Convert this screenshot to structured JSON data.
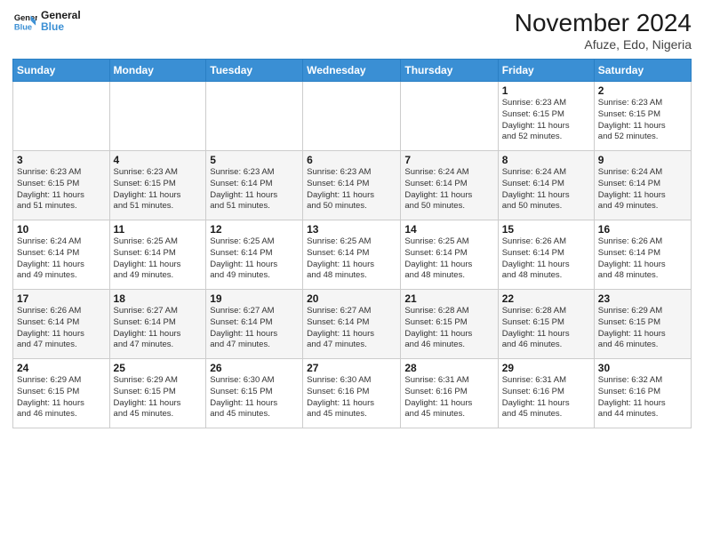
{
  "header": {
    "logo_line1": "General",
    "logo_line2": "Blue",
    "month": "November 2024",
    "location": "Afuze, Edo, Nigeria"
  },
  "weekdays": [
    "Sunday",
    "Monday",
    "Tuesday",
    "Wednesday",
    "Thursday",
    "Friday",
    "Saturday"
  ],
  "weeks": [
    [
      {
        "day": "",
        "info": ""
      },
      {
        "day": "",
        "info": ""
      },
      {
        "day": "",
        "info": ""
      },
      {
        "day": "",
        "info": ""
      },
      {
        "day": "",
        "info": ""
      },
      {
        "day": "1",
        "info": "Sunrise: 6:23 AM\nSunset: 6:15 PM\nDaylight: 11 hours\nand 52 minutes."
      },
      {
        "day": "2",
        "info": "Sunrise: 6:23 AM\nSunset: 6:15 PM\nDaylight: 11 hours\nand 52 minutes."
      }
    ],
    [
      {
        "day": "3",
        "info": "Sunrise: 6:23 AM\nSunset: 6:15 PM\nDaylight: 11 hours\nand 51 minutes."
      },
      {
        "day": "4",
        "info": "Sunrise: 6:23 AM\nSunset: 6:15 PM\nDaylight: 11 hours\nand 51 minutes."
      },
      {
        "day": "5",
        "info": "Sunrise: 6:23 AM\nSunset: 6:14 PM\nDaylight: 11 hours\nand 51 minutes."
      },
      {
        "day": "6",
        "info": "Sunrise: 6:23 AM\nSunset: 6:14 PM\nDaylight: 11 hours\nand 50 minutes."
      },
      {
        "day": "7",
        "info": "Sunrise: 6:24 AM\nSunset: 6:14 PM\nDaylight: 11 hours\nand 50 minutes."
      },
      {
        "day": "8",
        "info": "Sunrise: 6:24 AM\nSunset: 6:14 PM\nDaylight: 11 hours\nand 50 minutes."
      },
      {
        "day": "9",
        "info": "Sunrise: 6:24 AM\nSunset: 6:14 PM\nDaylight: 11 hours\nand 49 minutes."
      }
    ],
    [
      {
        "day": "10",
        "info": "Sunrise: 6:24 AM\nSunset: 6:14 PM\nDaylight: 11 hours\nand 49 minutes."
      },
      {
        "day": "11",
        "info": "Sunrise: 6:25 AM\nSunset: 6:14 PM\nDaylight: 11 hours\nand 49 minutes."
      },
      {
        "day": "12",
        "info": "Sunrise: 6:25 AM\nSunset: 6:14 PM\nDaylight: 11 hours\nand 49 minutes."
      },
      {
        "day": "13",
        "info": "Sunrise: 6:25 AM\nSunset: 6:14 PM\nDaylight: 11 hours\nand 48 minutes."
      },
      {
        "day": "14",
        "info": "Sunrise: 6:25 AM\nSunset: 6:14 PM\nDaylight: 11 hours\nand 48 minutes."
      },
      {
        "day": "15",
        "info": "Sunrise: 6:26 AM\nSunset: 6:14 PM\nDaylight: 11 hours\nand 48 minutes."
      },
      {
        "day": "16",
        "info": "Sunrise: 6:26 AM\nSunset: 6:14 PM\nDaylight: 11 hours\nand 48 minutes."
      }
    ],
    [
      {
        "day": "17",
        "info": "Sunrise: 6:26 AM\nSunset: 6:14 PM\nDaylight: 11 hours\nand 47 minutes."
      },
      {
        "day": "18",
        "info": "Sunrise: 6:27 AM\nSunset: 6:14 PM\nDaylight: 11 hours\nand 47 minutes."
      },
      {
        "day": "19",
        "info": "Sunrise: 6:27 AM\nSunset: 6:14 PM\nDaylight: 11 hours\nand 47 minutes."
      },
      {
        "day": "20",
        "info": "Sunrise: 6:27 AM\nSunset: 6:14 PM\nDaylight: 11 hours\nand 47 minutes."
      },
      {
        "day": "21",
        "info": "Sunrise: 6:28 AM\nSunset: 6:15 PM\nDaylight: 11 hours\nand 46 minutes."
      },
      {
        "day": "22",
        "info": "Sunrise: 6:28 AM\nSunset: 6:15 PM\nDaylight: 11 hours\nand 46 minutes."
      },
      {
        "day": "23",
        "info": "Sunrise: 6:29 AM\nSunset: 6:15 PM\nDaylight: 11 hours\nand 46 minutes."
      }
    ],
    [
      {
        "day": "24",
        "info": "Sunrise: 6:29 AM\nSunset: 6:15 PM\nDaylight: 11 hours\nand 46 minutes."
      },
      {
        "day": "25",
        "info": "Sunrise: 6:29 AM\nSunset: 6:15 PM\nDaylight: 11 hours\nand 45 minutes."
      },
      {
        "day": "26",
        "info": "Sunrise: 6:30 AM\nSunset: 6:15 PM\nDaylight: 11 hours\nand 45 minutes."
      },
      {
        "day": "27",
        "info": "Sunrise: 6:30 AM\nSunset: 6:16 PM\nDaylight: 11 hours\nand 45 minutes."
      },
      {
        "day": "28",
        "info": "Sunrise: 6:31 AM\nSunset: 6:16 PM\nDaylight: 11 hours\nand 45 minutes."
      },
      {
        "day": "29",
        "info": "Sunrise: 6:31 AM\nSunset: 6:16 PM\nDaylight: 11 hours\nand 45 minutes."
      },
      {
        "day": "30",
        "info": "Sunrise: 6:32 AM\nSunset: 6:16 PM\nDaylight: 11 hours\nand 44 minutes."
      }
    ]
  ]
}
